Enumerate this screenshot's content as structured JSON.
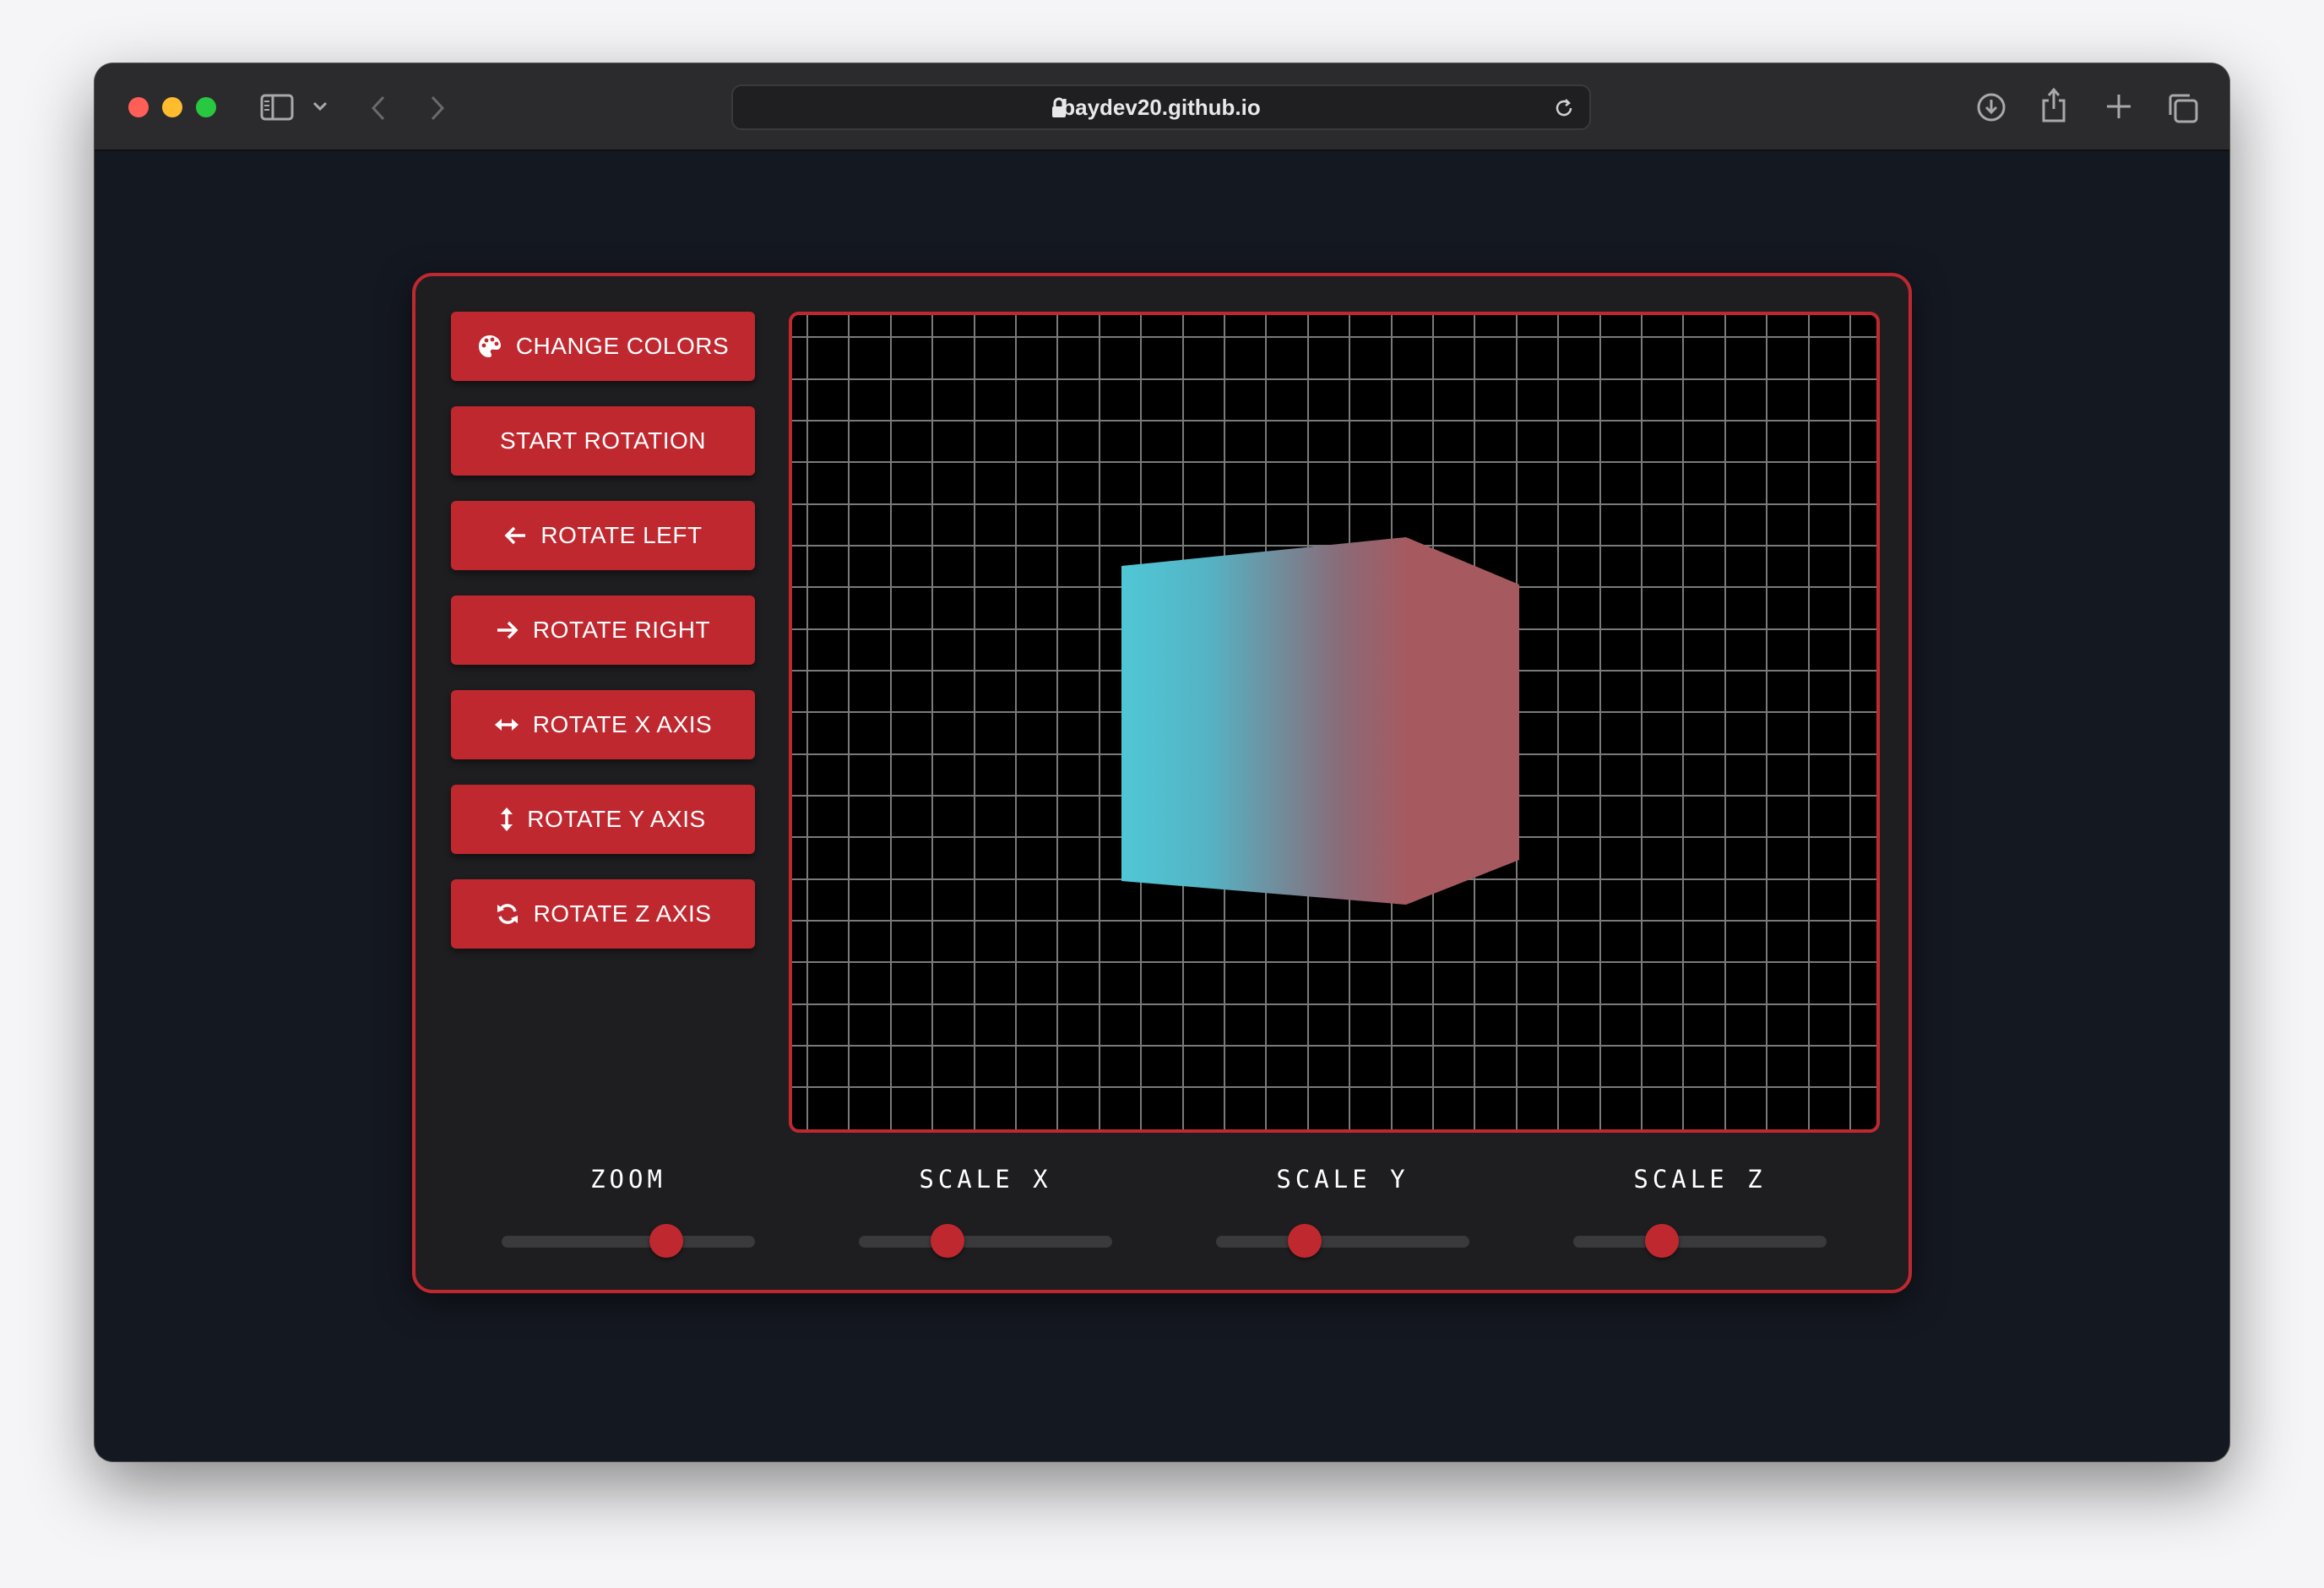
{
  "browser": {
    "url": "baydev20.github.io"
  },
  "controls": {
    "change_colors": "CHANGE COLORS",
    "start_rotation": "START ROTATION",
    "rotate_left": "ROTATE LEFT",
    "rotate_right": "ROTATE RIGHT",
    "rotate_x": "ROTATE X AXIS",
    "rotate_y": "ROTATE Y AXIS",
    "rotate_z": "ROTATE Z AXIS"
  },
  "sliders": [
    {
      "label": "ZOOM",
      "value_fraction": 0.65
    },
    {
      "label": "SCALE X",
      "value_fraction": 0.35
    },
    {
      "label": "SCALE Y",
      "value_fraction": 0.35
    },
    {
      "label": "SCALE Z",
      "value_fraction": 0.35
    }
  ],
  "cube": {
    "gradient_start": "#4fc7d6",
    "gradient_end": "#a65a60"
  },
  "colors": {
    "accent": "#c0282f",
    "page_background": "#141821",
    "panel_background": "#1e1e20",
    "grid_line": "#7a7a7a"
  }
}
